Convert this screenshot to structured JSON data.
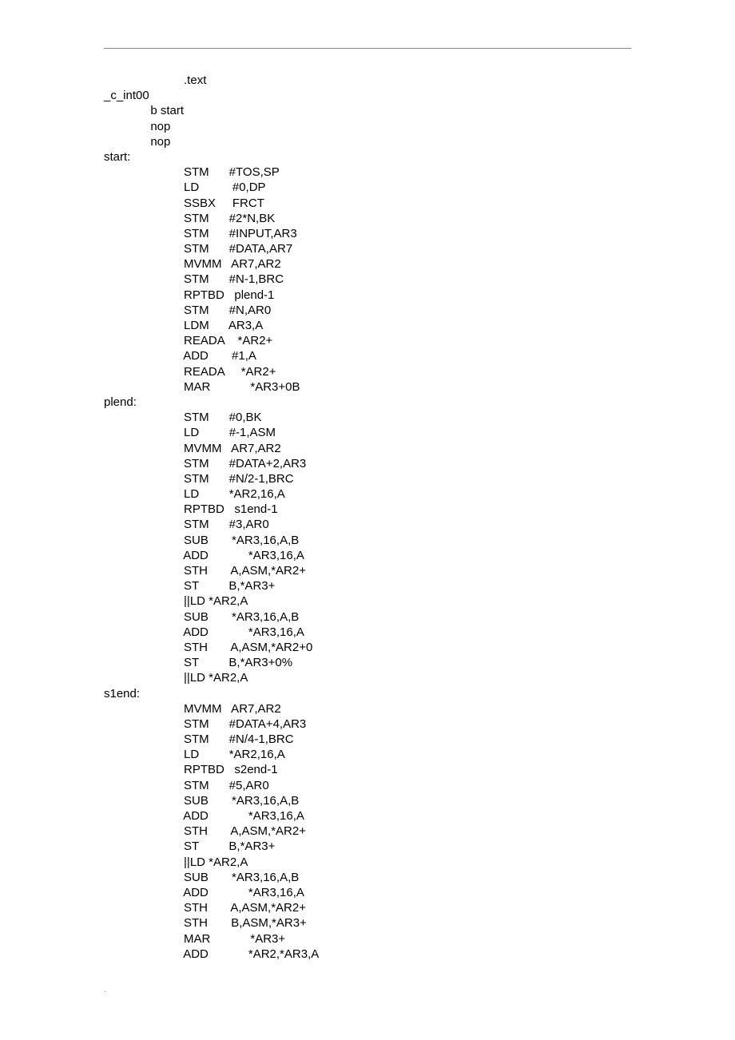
{
  "code_lines": [
    "                        .text",
    "_c_int00",
    "              b start",
    "              nop",
    "              nop",
    "start:",
    "                        STM      #TOS,SP",
    "                        LD          #0,DP",
    "                        SSBX     FRCT",
    "                        STM      #2*N,BK",
    "                        STM      #INPUT,AR3",
    "                        STM      #DATA,AR7",
    "                        MVMM   AR7,AR2",
    "                        STM      #N-1,BRC",
    "                        RPTBD   plend-1",
    "                        STM      #N,AR0",
    "                        LDM      AR3,A",
    "                        READA    *AR2+",
    "                        ADD       #1,A",
    "                        READA     *AR2+",
    "                        MAR            *AR3+0B",
    "plend:",
    "                        STM      #0,BK",
    "                        LD         #-1,ASM",
    "                        MVMM   AR7,AR2",
    "                        STM      #DATA+2,AR3",
    "                        STM      #N/2-1,BRC",
    "                        LD         *AR2,16,A",
    "                        RPTBD   s1end-1",
    "                        STM      #3,AR0",
    "                        SUB       *AR3,16,A,B",
    "                        ADD            *AR3,16,A",
    "                        STH       A,ASM,*AR2+",
    "                        ST         B,*AR3+",
    "                        ||LD *AR2,A",
    "                        SUB       *AR3,16,A,B",
    "                        ADD            *AR3,16,A",
    "                        STH       A,ASM,*AR2+0",
    "                        ST         B,*AR3+0%",
    "                        ||LD *AR2,A",
    "s1end:",
    "                        MVMM   AR7,AR2",
    "                        STM      #DATA+4,AR3",
    "                        STM      #N/4-1,BRC",
    "                        LD         *AR2,16,A",
    "                        RPTBD   s2end-1",
    "                        STM      #5,AR0",
    "                        SUB       *AR3,16,A,B",
    "                        ADD            *AR3,16,A",
    "                        STH       A,ASM,*AR2+",
    "                        ST         B,*AR3+",
    "                        ||LD *AR2,A",
    "                        SUB       *AR3,16,A,B",
    "                        ADD            *AR3,16,A",
    "                        STH       A,ASM,*AR2+",
    "                        STH       B,ASM,*AR3+",
    "                        MAR            *AR3+",
    "                        ADD            *AR2,*AR3,A"
  ],
  "hr_dot": ".",
  "footer_dot": "."
}
